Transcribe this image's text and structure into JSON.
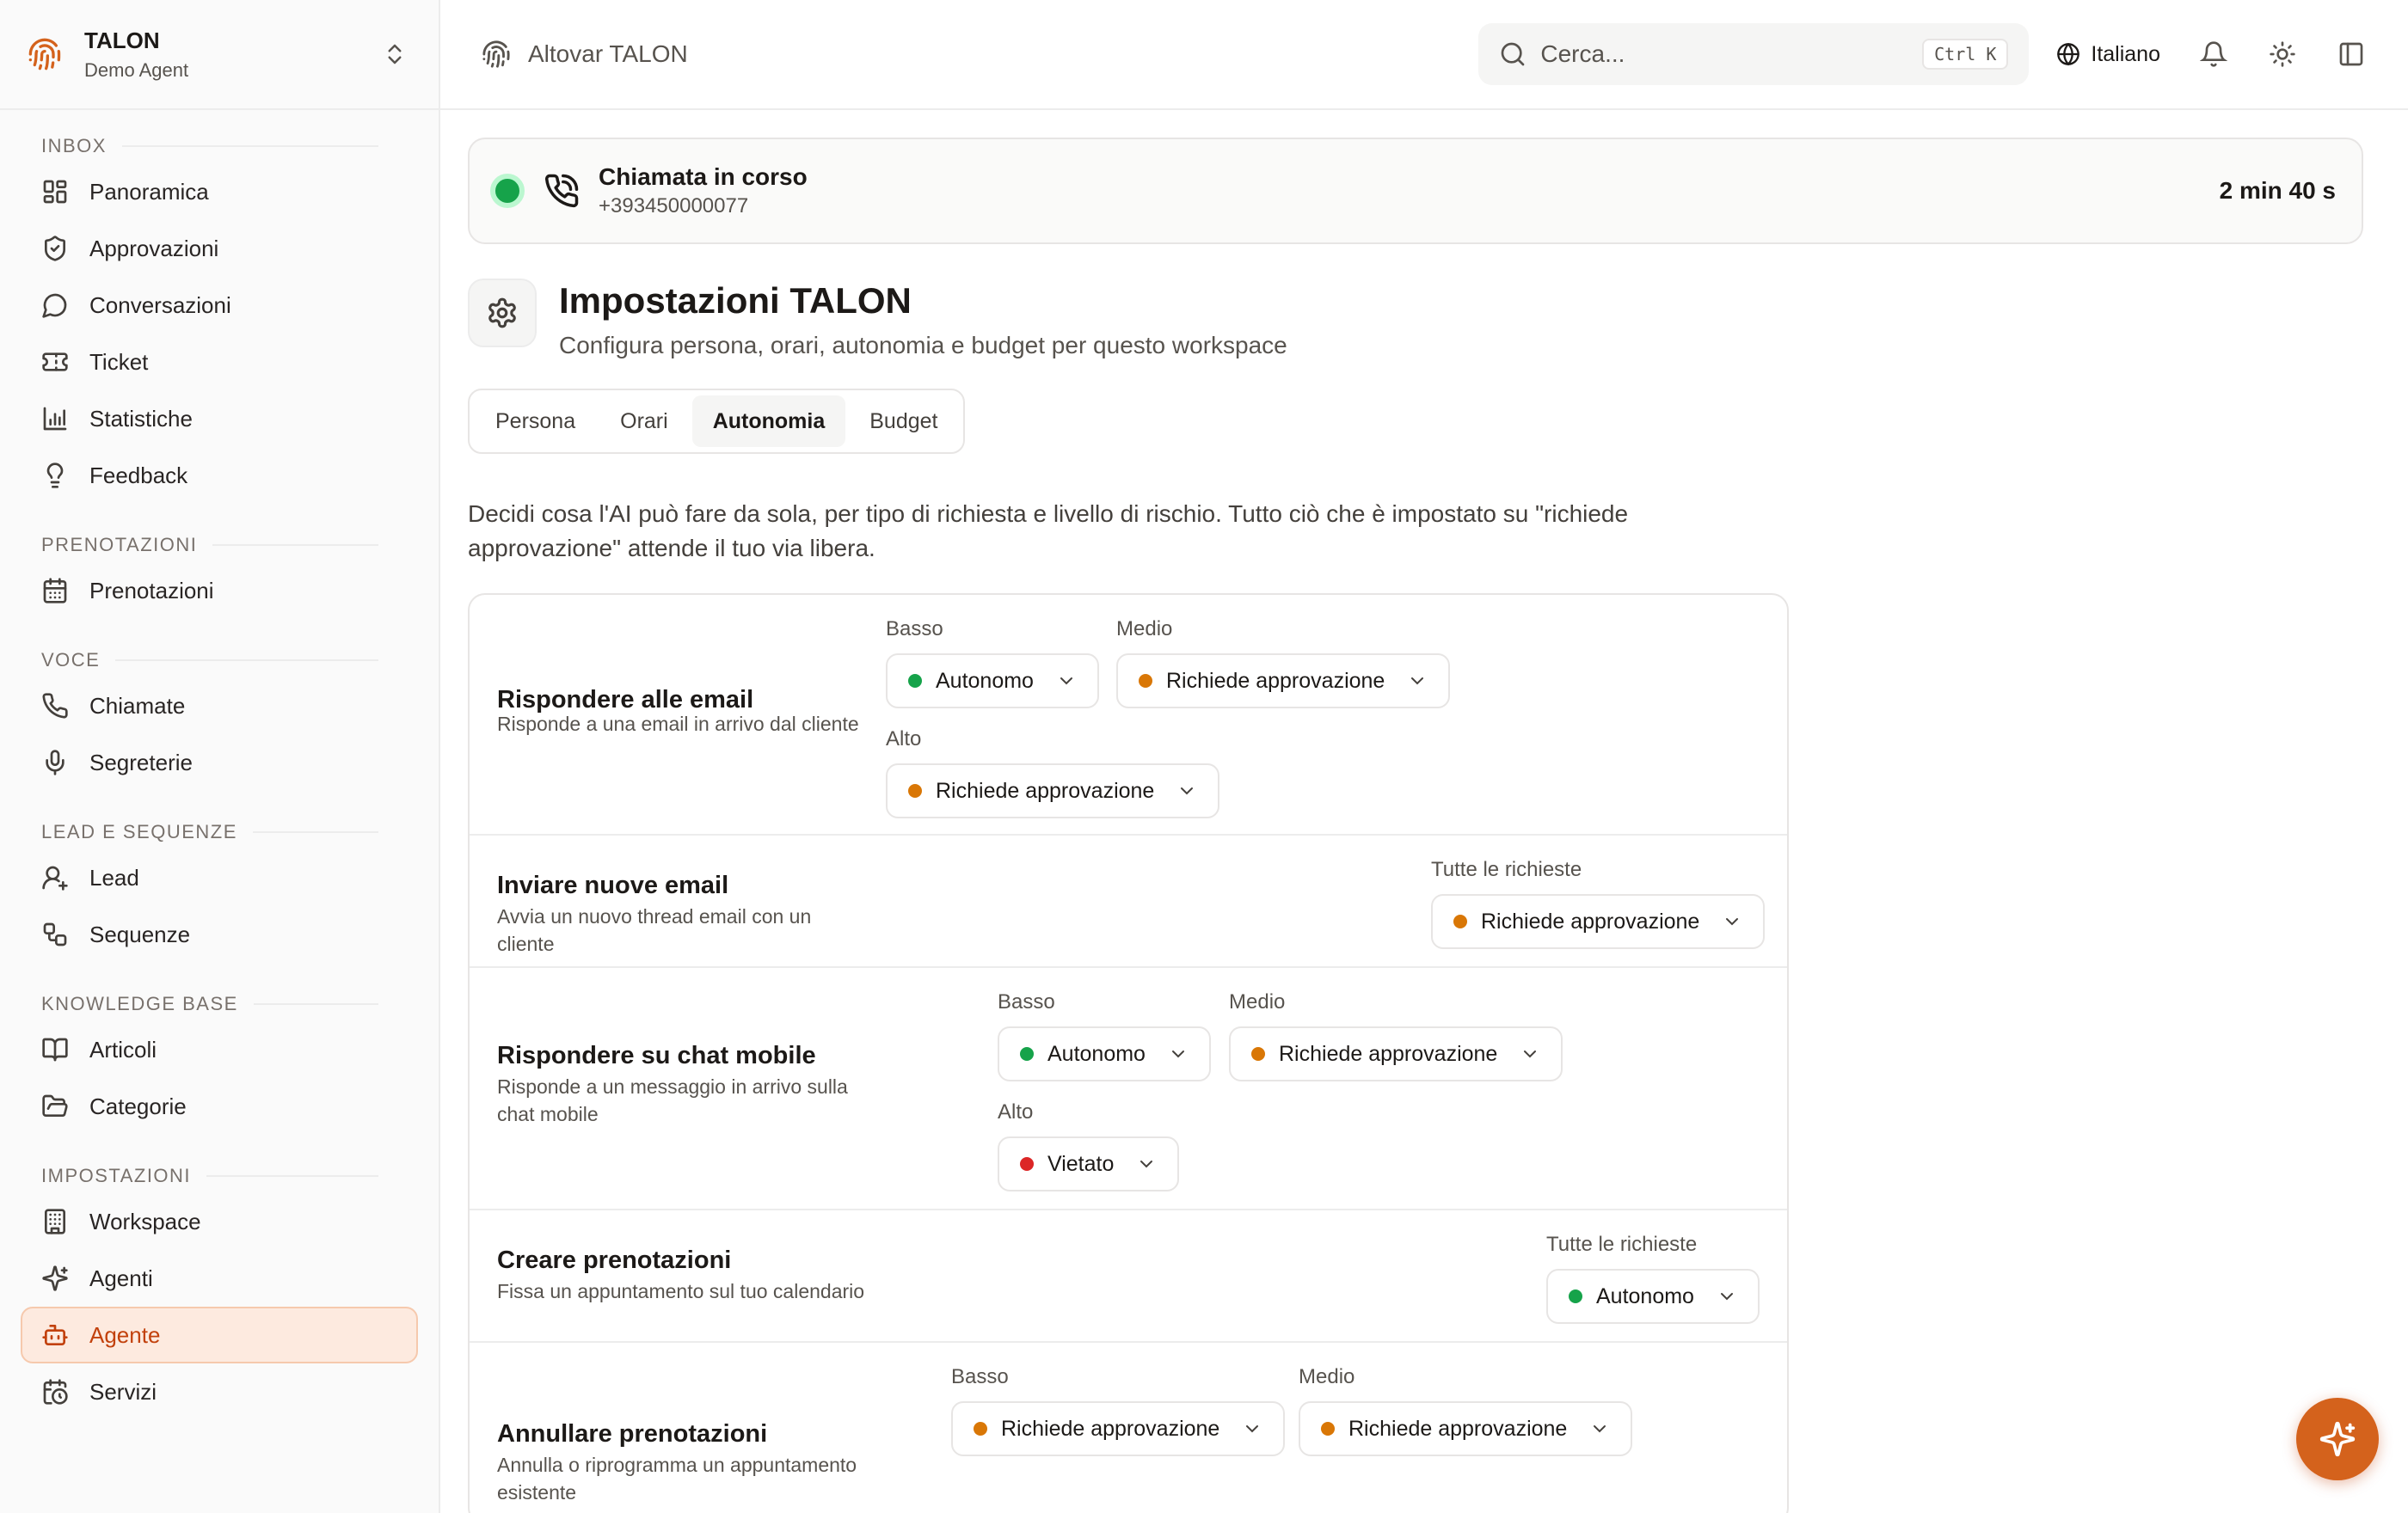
{
  "workspace": {
    "name": "TALON",
    "subtitle": "Demo Agent"
  },
  "sidebar": {
    "sections": [
      {
        "title": "INBOX",
        "items": [
          {
            "label": "Panoramica",
            "icon": "dashboard-icon"
          },
          {
            "label": "Approvazioni",
            "icon": "shield-check-icon"
          },
          {
            "label": "Conversazioni",
            "icon": "message-circle-icon"
          },
          {
            "label": "Ticket",
            "icon": "ticket-icon"
          },
          {
            "label": "Statistiche",
            "icon": "bar-chart-icon"
          },
          {
            "label": "Feedback",
            "icon": "lightbulb-icon"
          }
        ]
      },
      {
        "title": "PRENOTAZIONI",
        "items": [
          {
            "label": "Prenotazioni",
            "icon": "calendar-icon"
          }
        ]
      },
      {
        "title": "VOCE",
        "items": [
          {
            "label": "Chiamate",
            "icon": "phone-icon"
          },
          {
            "label": "Segreterie",
            "icon": "microphone-icon"
          }
        ]
      },
      {
        "title": "LEAD E SEQUENZE",
        "items": [
          {
            "label": "Lead",
            "icon": "user-icon"
          },
          {
            "label": "Sequenze",
            "icon": "workflow-icon"
          }
        ]
      },
      {
        "title": "KNOWLEDGE BASE",
        "items": [
          {
            "label": "Articoli",
            "icon": "book-icon"
          },
          {
            "label": "Categorie",
            "icon": "folder-icon"
          }
        ]
      },
      {
        "title": "IMPOSTAZIONI",
        "items": [
          {
            "label": "Workspace",
            "icon": "building-icon"
          },
          {
            "label": "Agenti",
            "icon": "sparkles-icon"
          },
          {
            "label": "Agente",
            "icon": "bot-icon",
            "active": true
          },
          {
            "label": "Servizi",
            "icon": "calendar-clock-icon"
          }
        ]
      }
    ]
  },
  "topbar": {
    "title": "Altovar TALON",
    "search_placeholder": "Cerca...",
    "search_shortcut": "Ctrl K",
    "language": "Italiano"
  },
  "call": {
    "title": "Chiamata in corso",
    "number": "+393450000077",
    "duration": "2 min 40 s"
  },
  "page": {
    "title": "Impostazioni TALON",
    "subtitle": "Configura persona, orari, autonomia e budget per questo workspace",
    "tabs": [
      {
        "label": "Persona"
      },
      {
        "label": "Orari"
      },
      {
        "label": "Autonomia",
        "active": true
      },
      {
        "label": "Budget"
      }
    ],
    "description": "Decidi cosa l'AI può fare da sola, per tipo di richiesta e livello di rischio. Tutto ciò che è impostato su \"richiede approvazione\" attende il tuo via libera."
  },
  "levels": {
    "low": "Basso",
    "medium": "Medio",
    "high": "Alto",
    "all": "Tutte le richieste"
  },
  "status_colors": {
    "Autonomo": "#16a34a",
    "Richiede approvazione": "#d97706",
    "Vietato": "#dc2626"
  },
  "accent_color": "#d4621c",
  "rules": [
    {
      "title": "Rispondere alle email",
      "description": "Risponde a una email in arrivo dal cliente",
      "low": "Autonomo",
      "medium": "Richiede approvazione",
      "high": "Richiede approvazione"
    },
    {
      "title": "Inviare nuove email",
      "description": "Avvia un nuovo thread email con un cliente",
      "all": "Richiede approvazione"
    },
    {
      "title": "Rispondere su chat mobile",
      "description": "Risponde a un messaggio in arrivo sulla chat mobile",
      "low": "Autonomo",
      "medium": "Richiede approvazione",
      "high": "Vietato"
    },
    {
      "title": "Creare prenotazioni",
      "description": "Fissa un appuntamento sul tuo calendario",
      "all": "Autonomo"
    },
    {
      "title": "Annullare prenotazioni",
      "description": "Annulla o riprogramma un appuntamento esistente",
      "low": "Richiede approvazione",
      "medium": "Richiede approvazione"
    }
  ]
}
